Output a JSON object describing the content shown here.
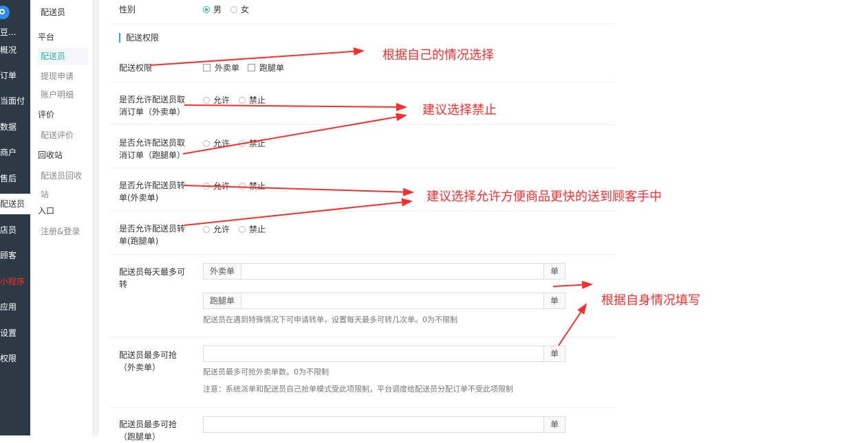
{
  "left_nav": {
    "store_name": "豆...",
    "items": [
      "概况",
      "订单",
      "当面付",
      "数据",
      "商户",
      "售后",
      "配送员",
      "店员",
      "顾客",
      "小程序",
      "应用",
      "设置",
      "权限"
    ],
    "active": "配送员",
    "highlight": "小程序"
  },
  "sub_nav": {
    "title": "配送员",
    "group_platform": "平台",
    "item_courier": "配送员",
    "item_withdraw": "提现申请",
    "item_account": "账户明细",
    "group_review": "评价",
    "item_review": "配送评价",
    "group_recycle": "回收站",
    "item_recycle_a": "配送员回收",
    "item_recycle_b": "站",
    "group_entry": "入口",
    "item_register": "注册&登录"
  },
  "form": {
    "gender_label": "性别",
    "gender_male": "男",
    "gender_female": "女",
    "section_title": "配送权限",
    "perm_label": "配送权限",
    "perm_takeout": "外卖单",
    "perm_errand": "跑腿单",
    "cancel_takeout_label_1": "是否允许配送员取",
    "cancel_takeout_label_2": "消订单（外卖单）",
    "cancel_errand_label_1": "是否允许配送员取",
    "cancel_errand_label_2": "消订单（跑腿单）",
    "transfer_takeout_label_1": "是否允许配送员转",
    "transfer_takeout_label_2": "单(外卖单)",
    "transfer_errand_label_1": "是否允许配送员转",
    "transfer_errand_label_2": "单(跑腿单)",
    "allow": "允许",
    "forbid": "禁止",
    "daily_transfer_label_1": "配送员每天最多可",
    "daily_transfer_label_2": "转",
    "prefix_takeout": "外卖单",
    "prefix_errand": "跑腿单",
    "unit": "单",
    "daily_transfer_help": "配送员在遇到特殊情况下可申请转单，设置每天最多可转几次单。0为不限制",
    "grab_takeout_label_1": "配送员最多可抢",
    "grab_takeout_label_2": "（外卖单）",
    "grab_takeout_help": "配送员最多可抢外卖单数。0为不限制",
    "grab_note": "注意：系统派单和配送员自己抢单模式受此项限制，平台调度给配送员分配订单不受此项限制",
    "grab_errand_label_1": "配送员最多可抢",
    "grab_errand_label_2": "（跑腿单）"
  },
  "annotations": {
    "a1": "根据自己的情况选择",
    "a2": "建议选择禁止",
    "a3": "建议选择允许方便商品更快的送到顾客手中",
    "a4": "根据自身情况填写"
  },
  "colors": {
    "accent": "#29b6a4",
    "annotation": "#ff2d2d",
    "nav_bg": "#2b3a45"
  }
}
